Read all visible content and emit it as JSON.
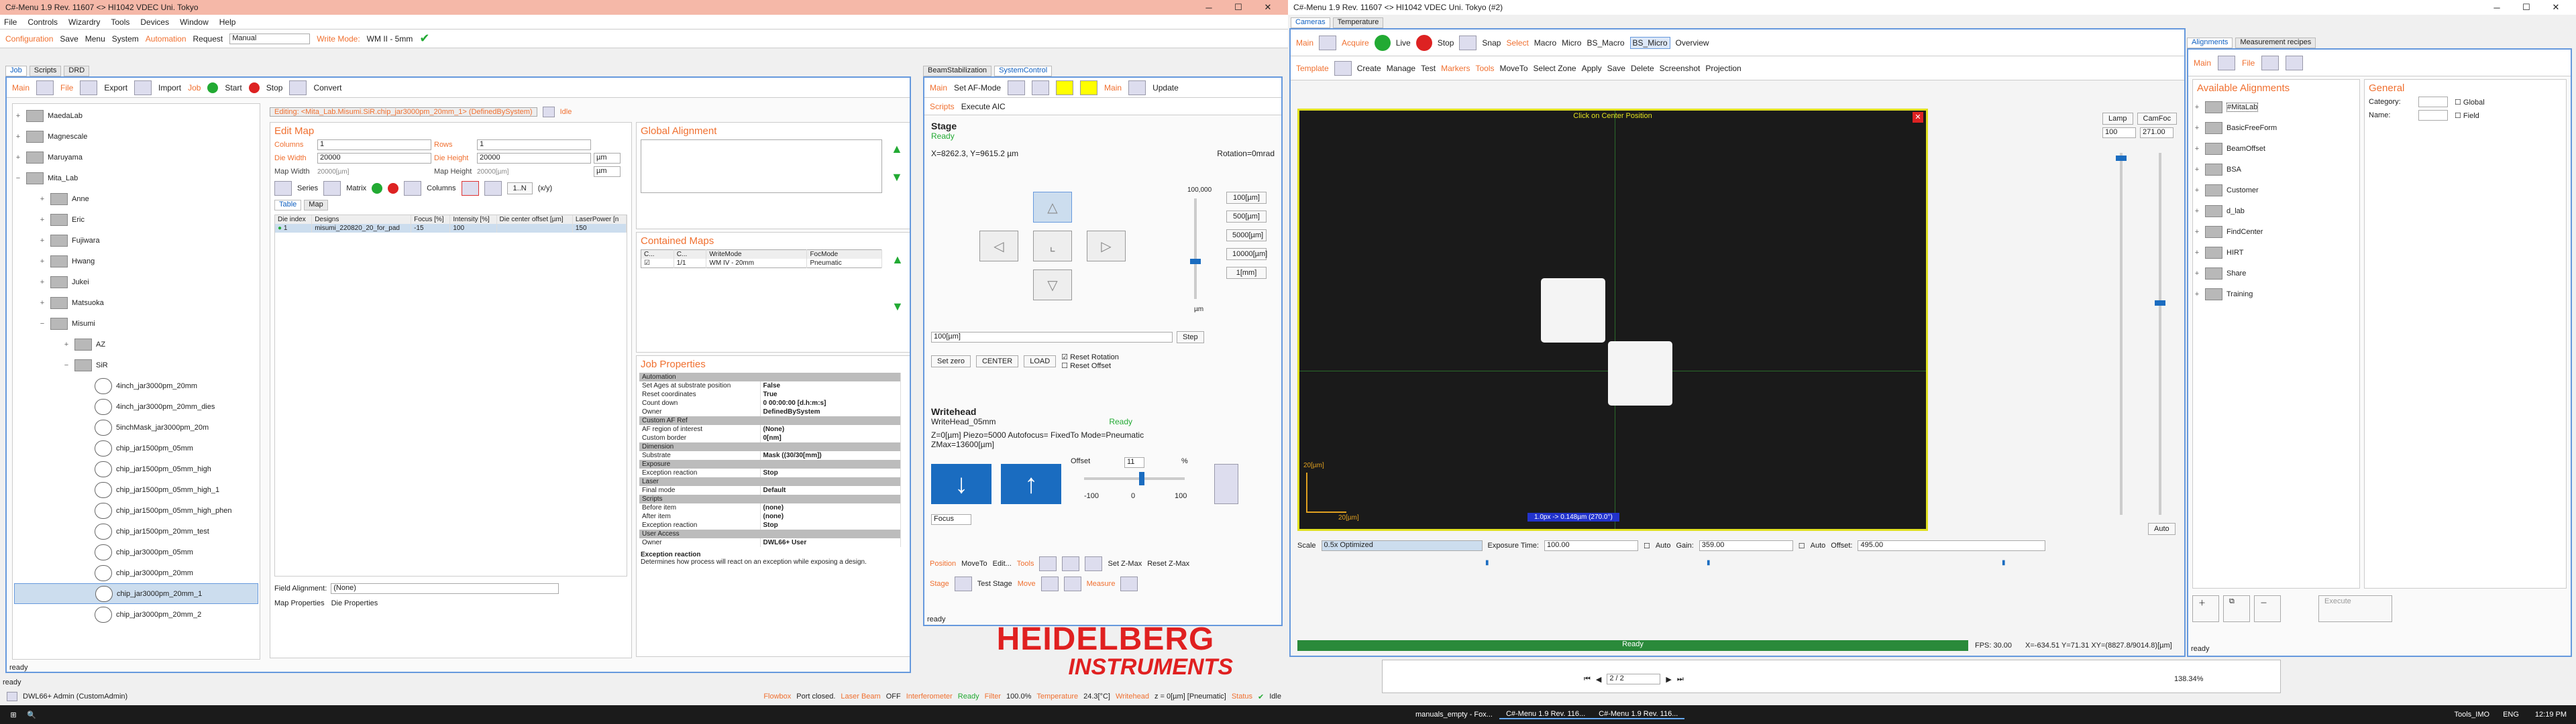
{
  "left": {
    "title": "C#-Menu 1.9 Rev. 11607 <> HI1042 VDEC Uni. Tokyo",
    "menu": [
      "File",
      "Controls",
      "Wizardry",
      "Tools",
      "Devices",
      "Window",
      "Help"
    ],
    "toolbar": {
      "configuration": "Configuration",
      "save": "Save",
      "menu": "Menu",
      "system": "System",
      "automation": "Automation",
      "request": "Request",
      "request_value": "Manual",
      "write_mode": "Write Mode:",
      "write_mode_value": "WM II - 5mm"
    },
    "tabs": [
      "Job",
      "Scripts",
      "DRD"
    ],
    "job_toolbar": {
      "main": "Main",
      "file": "File",
      "export": "Export",
      "import": "Import",
      "job": "Job",
      "start": "Start",
      "stop": "Stop",
      "convert": "Convert"
    },
    "tree": {
      "groups": [
        "MaedaLab",
        "Magnescale",
        "Maruyama",
        "Mita_Lab"
      ],
      "mita": [
        "Anne",
        "Eric",
        "Fujiwara",
        "Hwang",
        "Jukei",
        "Matsuoka",
        "Misumi"
      ],
      "misumi": [
        "AZ",
        "SiR"
      ],
      "sir_items": [
        "4inch_jar3000pm_20mm",
        "4inch_jar3000pm_20mm_dies",
        "5inchMask_jar3000pm_20m",
        "chip_jar1500pm_05mm",
        "chip_jar1500pm_05mm_high",
        "chip_jar1500pm_05mm_high_1",
        "chip_jar1500pm_05mm_high_phen",
        "chip_jar1500pm_20mm_test",
        "chip_jar3000pm_05mm",
        "chip_jar3000pm_20mm",
        "chip_jar3000pm_20mm_1",
        "chip_jar3000pm_20mm_2"
      ],
      "selected": "chip_jar3000pm_20mm_1"
    },
    "editing": "Editing: <Mita_Lab.Misumi.SiR.chip_jar3000pm_20mm_1> (DefinedBySystem)",
    "idle": "Idle",
    "edit_map": {
      "title": "Edit Map",
      "columns_label": "Columns",
      "columns": "1",
      "rows_label": "Rows",
      "rows": "1",
      "die_width_label": "Die Width",
      "die_width": "20000",
      "die_height_label": "Die Height",
      "die_height": "20000",
      "unit": "µm",
      "map_width_label": "Map Width",
      "map_width": "20000[µm]",
      "map_height_label": "Map Height",
      "map_height": "20000[µm]",
      "series": "Series",
      "matrix": "Matrix",
      "columns_btn": "Columns",
      "one_n": "1..N",
      "xy": "(x/y)",
      "tabs": [
        "Table",
        "Map"
      ],
      "headers": [
        "Die index",
        "Designs",
        "Focus [%]",
        "Intensity [%]",
        "Die center offset [µm]",
        "LaserPower [n"
      ],
      "row": [
        "1",
        "misumi_220820_20_for_pad",
        "-15",
        "100",
        "",
        "150"
      ]
    },
    "field_alignment_label": "Field Alignment:",
    "field_alignment": "(None)",
    "map_props": [
      "Map Properties",
      "Die Properties"
    ],
    "global_alignment": "Global Alignment",
    "contained_maps": {
      "title": "Contained Maps",
      "headers": [
        "C...",
        "C...",
        "WriteMode",
        "FocMode"
      ],
      "row": [
        "1/1",
        "WM IV - 20mm",
        "Pneumatic"
      ]
    },
    "job_properties": {
      "title": "Job Properties",
      "rows": [
        {
          "cat": "Automation"
        },
        {
          "k": "Set Ages at substrate position",
          "v": "False"
        },
        {
          "k": "Reset coordinates",
          "v": "True"
        },
        {
          "k": "Count down",
          "v": "0 00:00:00 [d.h:m:s]"
        },
        {
          "k": "Owner",
          "v": "DefinedBySystem"
        },
        {
          "cat": "Custom AF Ref"
        },
        {
          "k": "AF region of interest",
          "v": "(None)"
        },
        {
          "k": "Custom border",
          "v": "0[nm]"
        },
        {
          "cat": "Dimension"
        },
        {
          "k": "Substrate",
          "v": "Mask ((30/30[mm])"
        },
        {
          "cat": "Exposure"
        },
        {
          "k": "Exception reaction",
          "v": "Stop"
        },
        {
          "cat": "Laser"
        },
        {
          "k": "Final mode",
          "v": "Default"
        },
        {
          "cat": "Scripts"
        },
        {
          "k": "Before item",
          "v": "(none)"
        },
        {
          "k": "After item",
          "v": "(none)"
        },
        {
          "k": "Exception reaction",
          "v": "Stop"
        },
        {
          "cat": "User Access"
        },
        {
          "k": "Owner",
          "v": "DWL66+ User"
        }
      ],
      "desc_title": "Exception reaction",
      "desc": "Determines how process will react on an exception while exposing a design."
    },
    "stage": {
      "tabs": [
        "BeamStabilization",
        "SystemControl"
      ],
      "main": "Main",
      "set_af_mode": "Set AF-Mode",
      "update": "Update",
      "scripts": "Scripts",
      "execute_aic": "Execute AIC",
      "title": "Stage",
      "state": "Ready",
      "pos": "X=8262.3, Y=9615.2 µm",
      "rotation": "Rotation=0mrad",
      "scale_top": "100,000",
      "steps": [
        "100[µm]",
        "500[µm]",
        "5000[µm]",
        "10000[µm]",
        "1[mm]"
      ],
      "unit": "µm",
      "step_value": "100[µm]",
      "step": "Step",
      "set_zero": "Set zero",
      "center": "CENTER",
      "load": "LOAD",
      "reset_rotation": "Reset Rotation",
      "reset_offset": "Reset Offset",
      "writehead_title": "Writehead",
      "writehead_name": "WriteHead_05mm",
      "wh_state": "Ready",
      "wh_info": "Z=0[µm]   Piezo=5000   Autofocus= FixedTo   Mode=Pneumatic",
      "zmax": "ZMax=13600[µm]",
      "offset": "Offset",
      "offset_val": "11",
      "offset_unit": "%",
      "offset_min": "-100",
      "offset_zero": "0",
      "offset_max": "100",
      "focus": "Focus",
      "bottom": [
        "Position",
        "MoveTo",
        "Edit...",
        "Tools",
        "Set Z-Max",
        "Reset Z-Max",
        "Stage",
        "Test Stage",
        "Move",
        "Measure"
      ],
      "ready": "ready"
    },
    "logo1": "HEIDELBERG",
    "logo2": "INSTRUMENTS",
    "status": {
      "ready": "ready",
      "user": "DWL66+ Admin (CustomAdmin)",
      "flowbox": "Flowbox",
      "flowbox_v": "Port closed.",
      "laserbeam": "Laser Beam",
      "laserbeam_v": "OFF",
      "interferometer": "Interferometer",
      "interferometer_v": "Ready",
      "filter": "Filter",
      "filter_v": "100.0%",
      "temperature": "Temperature",
      "temperature_v": "24.3[°C]",
      "writehead": "Writehead",
      "writehead_v": "z = 0[µm] [Pneumatic]",
      "status": "Status",
      "status_v": "Idle"
    }
  },
  "right": {
    "title": "C#-Menu 1.9 Rev. 11607 <> HI1042 VDEC Uni. Tokyo (#2)",
    "tabs": [
      "Cameras",
      "Temperature"
    ],
    "cam_toolbar": [
      "Main",
      "Acquire",
      "Live",
      "Stop",
      "Snap",
      "Select",
      "Macro",
      "Micro",
      "BS_Macro",
      "BS_Micro",
      "Overview"
    ],
    "cam_toolbar2": [
      "Template",
      "Create",
      "Manage",
      "Test",
      "Markers",
      "Tools",
      "MoveTo",
      "Select Zone",
      "Apply",
      "Save",
      "Delete",
      "Screenshot",
      "Projection"
    ],
    "click_center": "Click on Center Position",
    "scalebar1": "20[µm]",
    "scalebar2": "20[µm]",
    "pixel_info": "1.0px -> 0.148µm (270.0°)",
    "lamp": "Lamp",
    "lamp_v": "100",
    "camfoc": "CamFoc",
    "camfoc_v": "271.00",
    "auto": "Auto",
    "scale_label": "Scale",
    "scale_v": "0.5x Optimized",
    "exposure_label": "Exposure Time:",
    "exposure_v": "100.00",
    "auto_lbl": "Auto",
    "gain_label": "Gain:",
    "gain_v": "359.00",
    "offset_label": "Offset:",
    "offset_v": "495.00",
    "ready": "Ready",
    "fps": "FPS: 30.00",
    "xy": "X=-634.51 Y=71.31 XY=(8827.8/9014.8)[µm]",
    "align_tabs": [
      "Alignments",
      "Measurement recipes"
    ],
    "align_toolbar": [
      "Main",
      "File"
    ],
    "available": "Available Alignments",
    "alignments": [
      "#MitaLab",
      "BasicFreeForm",
      "BeamOffset",
      "BSA",
      "Customer",
      "d_lab",
      "FindCenter",
      "HIRT",
      "Share",
      "Training"
    ],
    "general": "General",
    "category": "Category:",
    "name": "Name:",
    "global": "Global",
    "field": "Field",
    "execute": "Execute",
    "align_ready": "ready",
    "pdf_page": "2 / 2",
    "pdf_zoom": "138.34%"
  },
  "taskbar": {
    "items": [
      "manuals_empty - Fox...",
      "C#-Menu 1.9 Rev. 116...",
      "C#-Menu 1.9 Rev. 116..."
    ],
    "time": "12:19 PM",
    "lang": "ENG",
    "tools": "Tools_IMO"
  },
  "colors": {
    "accent": "#f07030",
    "frame": "#6699dd",
    "brand_red": "#e02020",
    "camera_border": "#e0e020"
  }
}
